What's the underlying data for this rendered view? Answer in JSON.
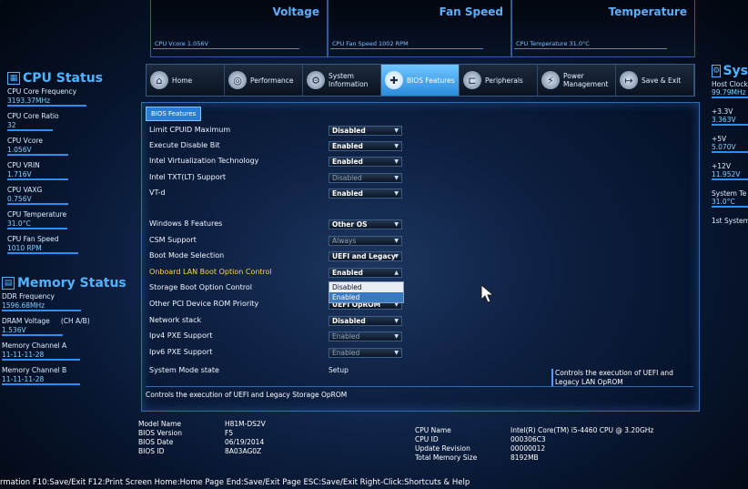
{
  "top_monitor": {
    "voltage": {
      "title": "Voltage",
      "label": "CPU Vcore      1.056V"
    },
    "fan": {
      "title": "Fan Speed",
      "label": "CPU Fan Speed      1002 RPM"
    },
    "temperature": {
      "title": "Temperature",
      "label": "CPU Temperature      31.0°C"
    }
  },
  "cpu_status": {
    "title": "CPU Status",
    "items": [
      {
        "label": "CPU Core Frequency",
        "value": "3193.37MHz"
      },
      {
        "label": "CPU Core Ratio",
        "value": "32"
      },
      {
        "label": "CPU Vcore",
        "value": "1.056V"
      },
      {
        "label": "CPU VRIN",
        "value": "1.716V"
      },
      {
        "label": "CPU VAXG",
        "value": "0.756V"
      },
      {
        "label": "CPU Temperature",
        "value": "31.0°C"
      },
      {
        "label": "CPU Fan Speed",
        "value": "1010 RPM"
      }
    ]
  },
  "memory_status": {
    "title": "Memory Status",
    "items": [
      {
        "label": "DDR Frequency",
        "value": "1596.68MHz"
      },
      {
        "label": "DRAM Voltage",
        "extra": "(CH A/B)",
        "value": "1.536V"
      },
      {
        "label": "Memory Channel A",
        "value": "11-11-11-28"
      },
      {
        "label": "Memory Channel B",
        "value": "11-11-11-28"
      }
    ]
  },
  "tabs": [
    {
      "label": "Home",
      "icon": "home-icon",
      "glyph": "⌂"
    },
    {
      "label": "Performance",
      "icon": "gauge-icon",
      "glyph": "◎"
    },
    {
      "label": "System Information",
      "icon": "gear-icon",
      "glyph": "⚙"
    },
    {
      "label": "BIOS Features",
      "icon": "bios-icon",
      "glyph": "✚"
    },
    {
      "label": "Peripherals",
      "icon": "peripherals-icon",
      "glyph": "⊏"
    },
    {
      "label": "Power Management",
      "icon": "power-icon",
      "glyph": "⚡"
    },
    {
      "label": "Save & Exit",
      "icon": "exit-icon",
      "glyph": "↦"
    }
  ],
  "section_tab": "BIOS Features",
  "settings": [
    {
      "label": "Limit CPUID Maximum",
      "value": "Disabled",
      "dim": false
    },
    {
      "label": "Execute Disable Bit",
      "value": "Enabled",
      "dim": false
    },
    {
      "label": "Intel Virtualization Technology",
      "value": "Enabled",
      "dim": false
    },
    {
      "label": "Intel TXT(LT) Support",
      "value": "Disabled",
      "dim": true
    },
    {
      "label": "VT-d",
      "value": "Enabled",
      "dim": false
    },
    {
      "label": "Windows 8 Features",
      "value": "Other OS",
      "dim": false
    },
    {
      "label": "CSM Support",
      "value": "Always",
      "dim": true
    },
    {
      "label": "Boot Mode Selection",
      "value": "UEFI and Legacy",
      "dim": false
    },
    {
      "label": "Onboard LAN Boot Option Control",
      "value": "Enabled",
      "dim": false,
      "highlight": true
    },
    {
      "label": "Storage Boot Option Control",
      "value": "",
      "dim": false
    },
    {
      "label": "Other PCI Device ROM Priority",
      "value": "UEFI OpROM",
      "dim": false
    },
    {
      "label": "Network stack",
      "value": "Disabled",
      "dim": false
    },
    {
      "label": "Ipv4 PXE Support",
      "value": "Enabled",
      "dim": true
    },
    {
      "label": "Ipv6 PXE Support",
      "value": "Enabled",
      "dim": true
    },
    {
      "label": "System Mode state",
      "value": "Setup",
      "static": true
    }
  ],
  "dropdown_options": [
    "Disabled",
    "Enabled"
  ],
  "dropdown_selected": "Enabled",
  "help_text": "Controls the execution of UEFI and Legacy LAN OpROM",
  "description": "Controls the execution of UEFI and Legacy Storage OpROM",
  "board_info": [
    {
      "k": "Model Name",
      "v": "H81M-DS2V"
    },
    {
      "k": "BIOS Version",
      "v": "F5"
    },
    {
      "k": "BIOS Date",
      "v": "06/19/2014"
    },
    {
      "k": "BIOS ID",
      "v": "8A03AG0Z"
    }
  ],
  "cpu_info": [
    {
      "k": "CPU Name",
      "v": "Intel(R) Core(TM) i5-4460  CPU @ 3.20GHz"
    },
    {
      "k": "CPU ID",
      "v": "000306C3"
    },
    {
      "k": "Update Revision",
      "v": "00000012"
    },
    {
      "k": "Total Memory Size",
      "v": "8192MB"
    }
  ],
  "footer": "rmation F10:Save/Exit F12:Print Screen Home:Home Page End:Save/Exit Page ESC:Save/Exit Right-Click:Shortcuts & Help",
  "system_status": {
    "title": "Sys",
    "items": [
      {
        "label": "Host Clock",
        "value": "99.79MHz"
      },
      {
        "label": "+3.3V",
        "value": "3.363V"
      },
      {
        "label": "+5V",
        "value": "5.070V"
      },
      {
        "label": "+12V",
        "value": "11.952V"
      },
      {
        "label": "System Te",
        "value": "31.0°C"
      },
      {
        "label": "1st System",
        "value": ""
      }
    ]
  }
}
